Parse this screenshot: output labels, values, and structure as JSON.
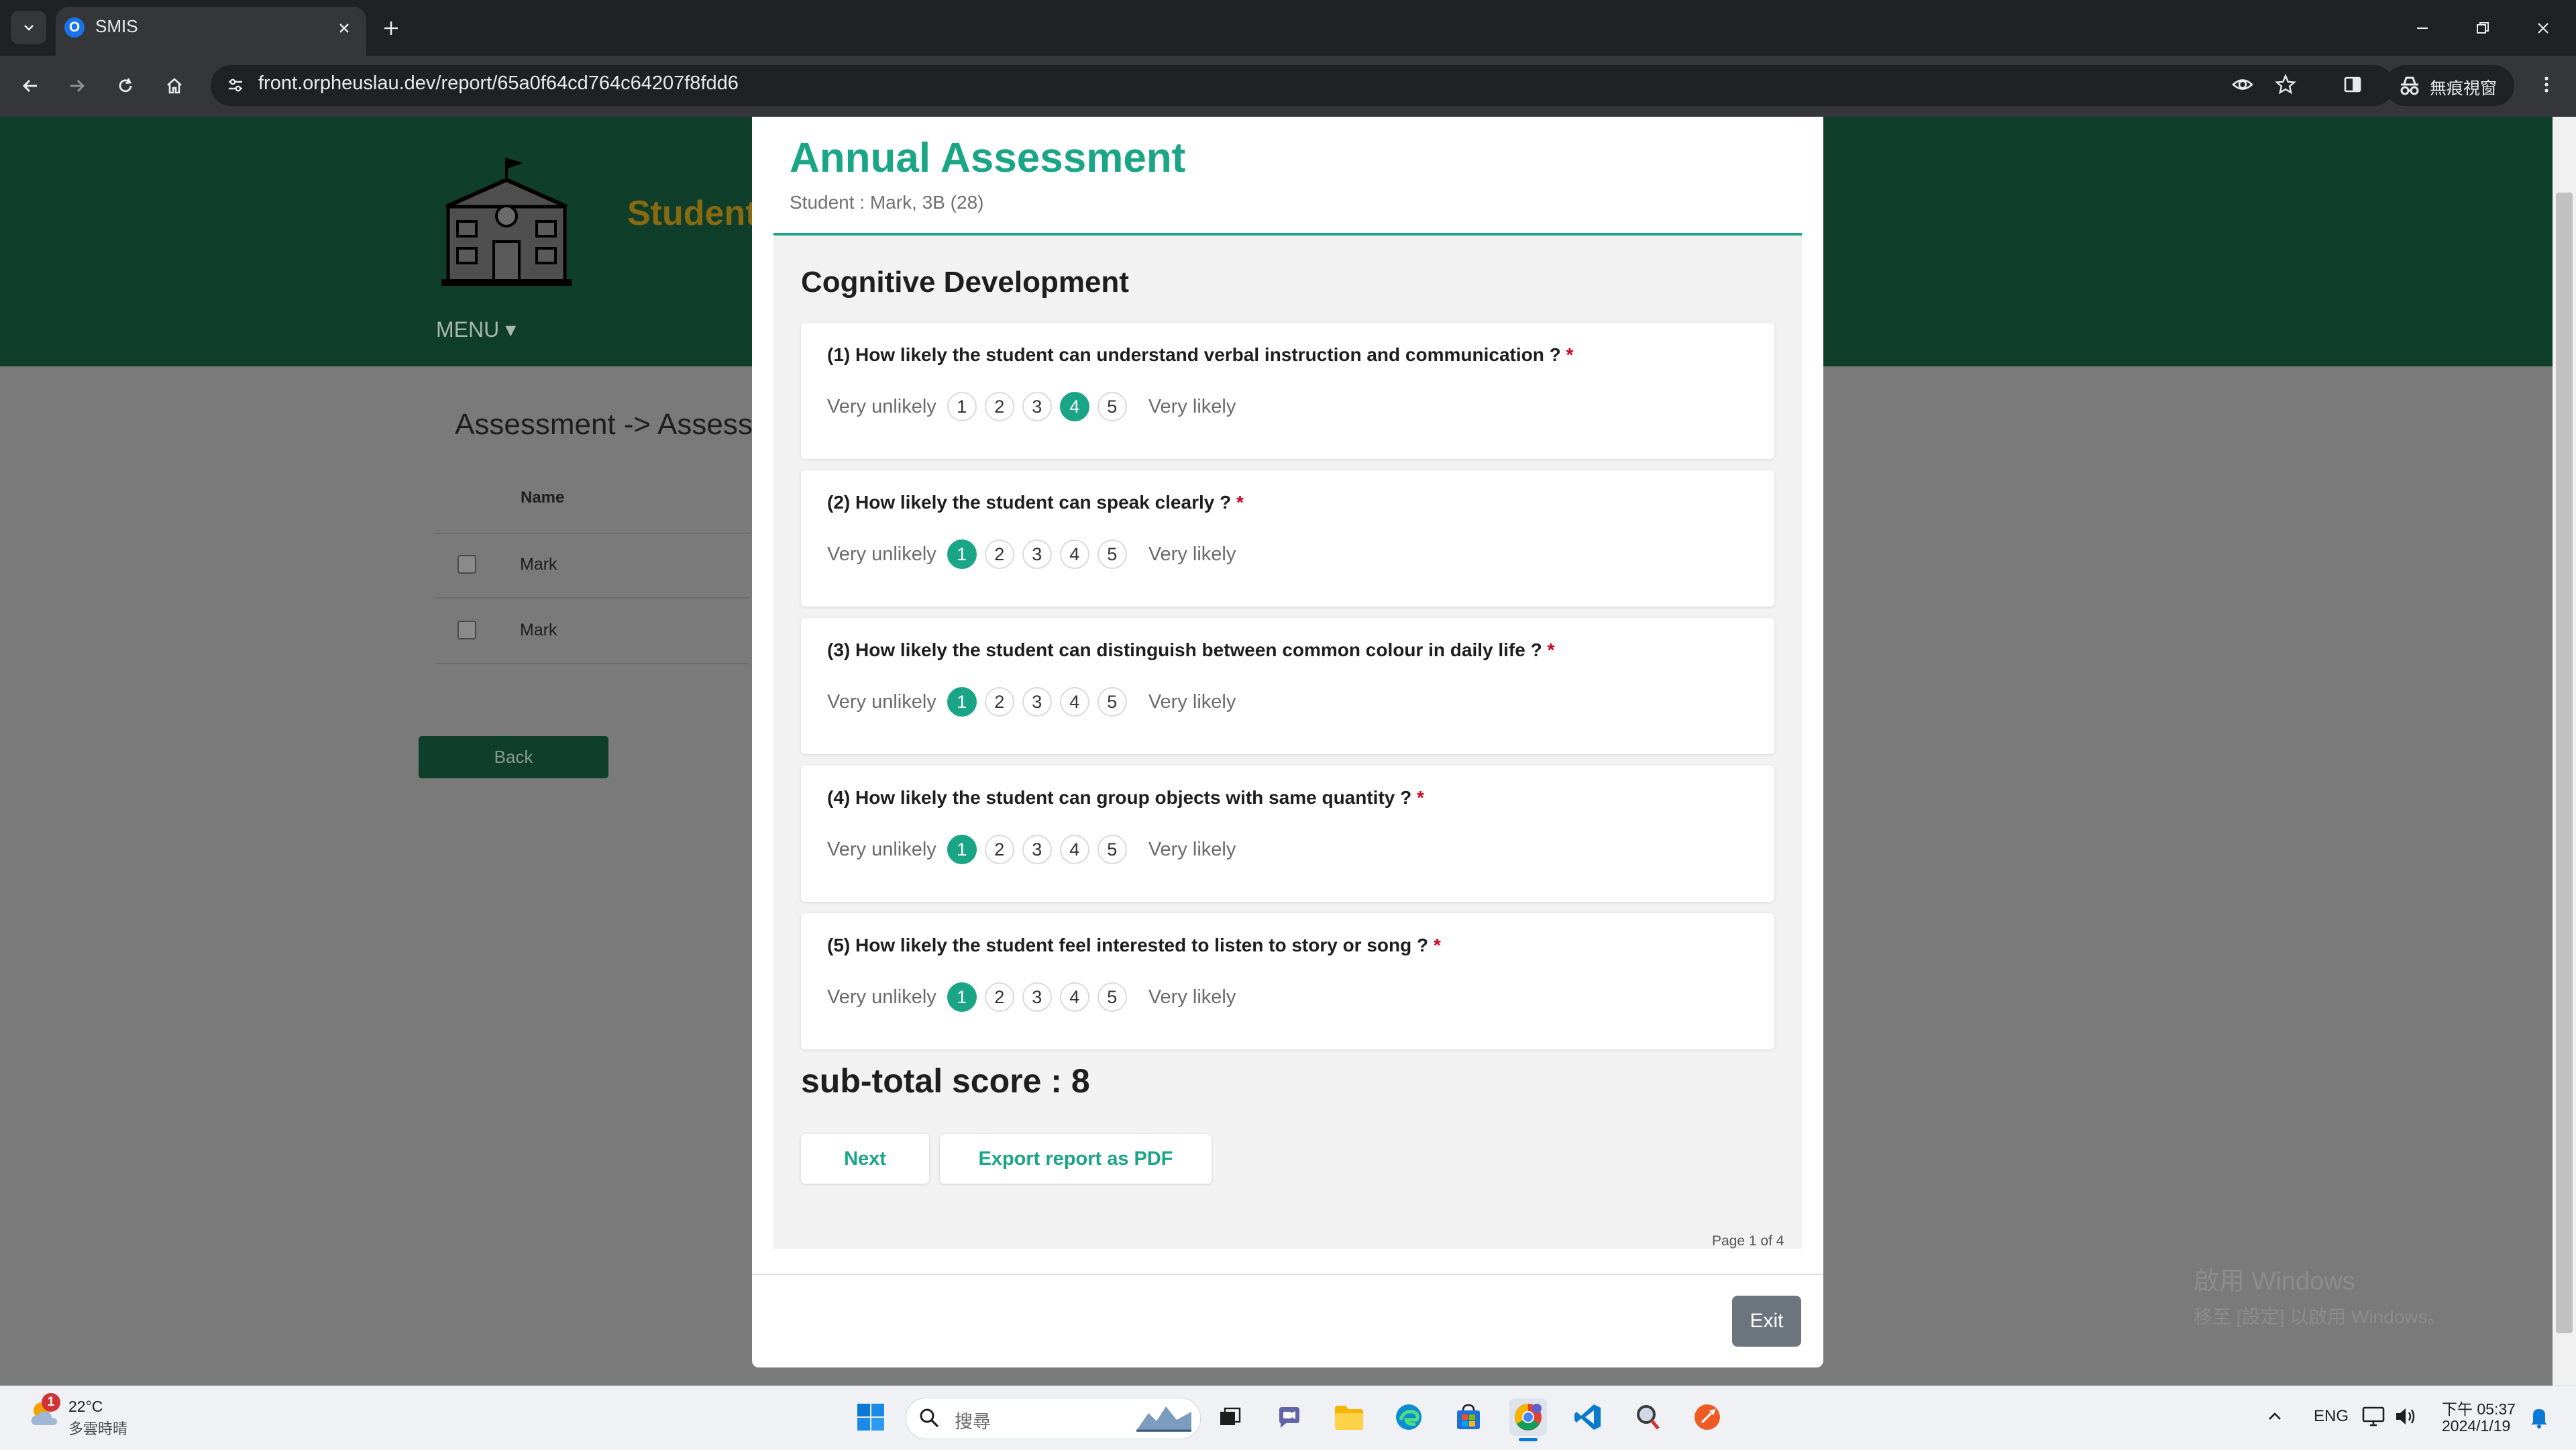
{
  "browser": {
    "tab_title": "SMIS",
    "tab_favicon": "O",
    "url": "front.orpheuslau.dev/report/65a0f64cd764c64207f8fdd6",
    "incognito_label": "無痕視窗"
  },
  "page": {
    "brand": "Student",
    "menu_label": "MENU ▾",
    "breadcrumb": "Assessment -> Assessm",
    "table": {
      "column_name": "Name",
      "rows": [
        {
          "name": "Mark"
        },
        {
          "name": "Mark"
        }
      ]
    },
    "back_label": "Back",
    "activation": {
      "title": "啟用 Windows",
      "subtitle": "移至 [設定] 以啟用 Windows。"
    }
  },
  "modal": {
    "title": "Annual Assessment",
    "subtitle": "Student : Mark, 3B (28)",
    "section_title": "Cognitive Development",
    "scale_low": "Very unlikely",
    "scale_high": "Very likely",
    "scale_options": [
      "1",
      "2",
      "3",
      "4",
      "5"
    ],
    "questions": [
      {
        "text": "(1) How likely the student can understand verbal instruction and communication ?",
        "required": "*",
        "selected": 4
      },
      {
        "text": "(2) How likely the student can speak clearly ?",
        "required": "*",
        "selected": 1
      },
      {
        "text": "(3) How likely the student can distinguish between common colour in daily life ?",
        "required": "*",
        "selected": 1
      },
      {
        "text": "(4) How likely the student can group objects with same quantity ?",
        "required": "*",
        "selected": 1
      },
      {
        "text": "(5) How likely the student feel interested to listen to story or song ?",
        "required": "*",
        "selected": 1
      }
    ],
    "subtotal": "sub-total score : 8",
    "next_label": "Next",
    "export_label": "Export report as PDF",
    "page_indicator": "Page 1 of 4",
    "exit_label": "Exit"
  },
  "taskbar": {
    "weather_badge": "1",
    "weather_temp": "22°C",
    "weather_desc": "多雲時晴",
    "search_placeholder": "搜尋",
    "lang": "ENG",
    "time": "下午 05:37",
    "date": "2024/1/19"
  },
  "colors": {
    "accent": "#1aa587",
    "header_green": "#0f3e2b",
    "required": "#d0021b"
  }
}
